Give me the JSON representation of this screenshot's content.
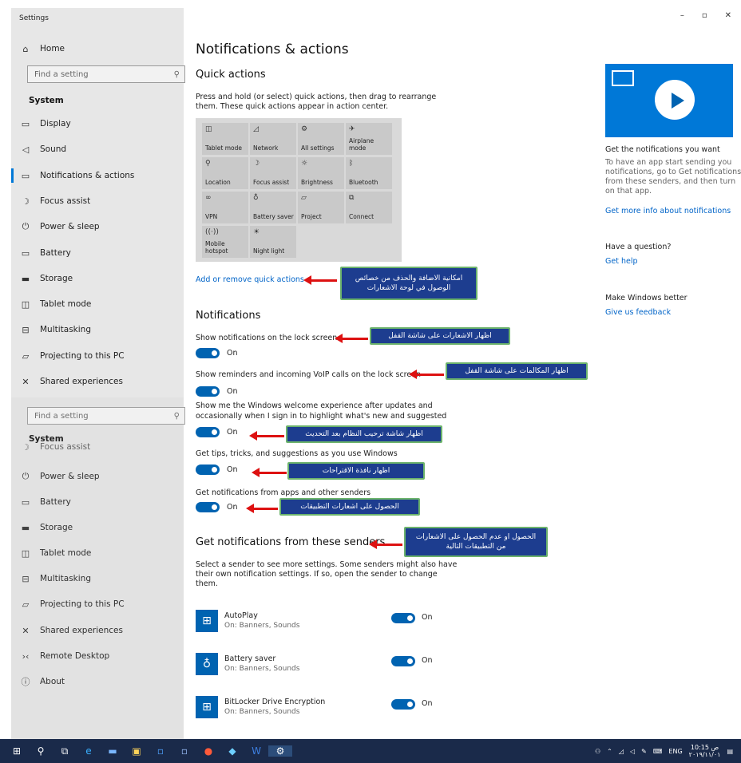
{
  "window": {
    "title": "Settings",
    "minimize": "–",
    "maximize": "▫",
    "close": "✕"
  },
  "sidebar": {
    "home": "Home",
    "search_placeholder": "Find a setting",
    "section": "System",
    "items": [
      "Display",
      "Sound",
      "Notifications & actions",
      "Focus assist",
      "Power & sleep",
      "Battery",
      "Storage",
      "Tablet mode",
      "Multitasking",
      "Projecting to this PC",
      "Shared experiences"
    ],
    "lower_search_placeholder": "Find a setting",
    "lower_section": "System",
    "lower_partial": "Focus assist",
    "lower_items": [
      "Power & sleep",
      "Battery",
      "Storage",
      "Tablet mode",
      "Multitasking",
      "Projecting to this PC",
      "Shared experiences",
      "Remote Desktop",
      "About"
    ]
  },
  "main": {
    "title": "Notifications & actions",
    "quick_actions": {
      "heading": "Quick actions",
      "desc1": "Press and hold (or select) quick actions, then drag to rearrange",
      "desc2": "them. These quick actions appear in action center.",
      "tiles": [
        "Tablet mode",
        "Network",
        "All settings",
        "Airplane mode",
        "Location",
        "Focus assist",
        "Brightness",
        "Bluetooth",
        "VPN",
        "Battery saver",
        "Project",
        "Connect",
        "Mobile hotspot",
        "Night light"
      ],
      "add_remove_link": "Add or remove quick actions"
    },
    "notifications": {
      "heading": "Notifications",
      "lock_screen": "Show notifications on the lock screen",
      "voip": "Show reminders and incoming VoIP calls on the lock screen",
      "welcome1": "Show me the Windows welcome experience after updates and",
      "welcome2": "occasionally when I sign in to highlight what's new and suggested",
      "tips": "Get tips, tricks, and suggestions as you use Windows",
      "apps": "Get notifications from apps and other senders",
      "on_label": "On"
    },
    "senders": {
      "heading": "Get notifications from these senders",
      "desc1": "Select a sender to see more settings. Some senders might also have",
      "desc2": "their own notification settings. If so, open the sender to change",
      "desc3": "them.",
      "list": [
        {
          "name": "AutoPlay",
          "sub": "On: Banners, Sounds",
          "state": "On"
        },
        {
          "name": "Battery saver",
          "sub": "On: Banners, Sounds",
          "state": "On"
        },
        {
          "name": "BitLocker Drive Encryption",
          "sub": "On: Banners, Sounds",
          "state": "On"
        }
      ]
    }
  },
  "right": {
    "get_title": "Get the notifications you want",
    "get_body1": "To have an app start sending you",
    "get_body2": "notifications, go to Get notifications",
    "get_body3": "from these senders, and then turn",
    "get_body4": "on that app.",
    "more_info_link": "Get more info about notifications",
    "question": "Have a question?",
    "help_link": "Get help",
    "better": "Make Windows better",
    "feedback_link": "Give us feedback"
  },
  "annotations": {
    "quick_actions_1": "امكانية الاضافة والحذف من خصائص",
    "quick_actions_2": "الوصول في لوحة الاشعارات",
    "lock_screen": "اظهار الاشعارات على شاشة القفل",
    "voip": "اظهار المكالمات على شاشة القفل",
    "welcome": "اظهار شاشة ترحيب النظام بعد التحديث",
    "tips": "اظهار نافذة الاقتراحات",
    "apps": "الحصول على اشعارات التطبيقات",
    "senders_1": "الحصول او عدم الحصول على الاشعارات",
    "senders_2": "من التطبيقات التالية"
  },
  "taskbar": {
    "lang": "ENG",
    "time": "10:15 ص",
    "date": "٢٠١٩/١١/٠١"
  },
  "colors": {
    "accent": "#0078d7",
    "toggle": "#0063b1",
    "note_bg": "#1d3d8f",
    "arrow": "#dd1111"
  }
}
